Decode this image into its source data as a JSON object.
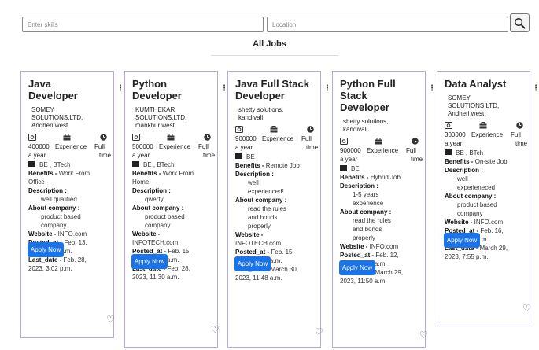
{
  "search": {
    "skills_placeholder": "Enter skills",
    "location_placeholder": "Location"
  },
  "page": {
    "title": "All Jobs"
  },
  "labels": {
    "benefits": "Benefits -",
    "description": "Description :",
    "about": "About company :",
    "website": "Website -",
    "posted": "Posted_at -",
    "last": "Last_date -",
    "apply": "Apply Now",
    "experience": "Experience",
    "full": "Full",
    "time": "time",
    "a_year": "a year"
  },
  "icons": {
    "salary": "money-icon",
    "experience": "briefcase-icon",
    "type": "clock-icon",
    "education": "graduation-cap-icon",
    "favorite": "heart-icon",
    "more": "kebab-menu-icon",
    "search": "magnifier-icon"
  },
  "colors": {
    "card_border": "#b9a8e3",
    "apply_button": "#1a73e8"
  },
  "jobs": [
    {
      "title_lines": [
        "Java",
        "Developer"
      ],
      "company_lines": [
        "SOMEY",
        "SOLUTIONS.LTD,",
        "Andheri west."
      ],
      "salary": "400000",
      "education": "BE , BTech",
      "benefits_lines": [
        "Work From",
        "Office"
      ],
      "description_lines": [
        "well qualified"
      ],
      "about_lines": [
        "product based",
        "company"
      ],
      "website": "INFO.com",
      "posted_lines": [
        "Feb. 13,",
        "2023, 3:02 p.m."
      ],
      "last_lines": [
        "Feb. 28,",
        "2023, 3:02 p.m."
      ]
    },
    {
      "title_lines": [
        "Python",
        "Developer"
      ],
      "company_lines": [
        "KUMTHEKAR",
        "SOLUTIONS.LTD,",
        "mankhur west."
      ],
      "salary": "500000",
      "education": "BE , BTech",
      "benefits_lines": [
        "Work From",
        "Home"
      ],
      "description_lines": [
        "qwerty"
      ],
      "about_lines": [
        "product based",
        "company"
      ],
      "website": "INFOTECH.com",
      "website_split": true,
      "posted_lines": [
        "Feb. 15,",
        "2023, 11:32 a.m."
      ],
      "last_lines": [
        "Feb. 28,",
        "2023, 11:30 a.m."
      ]
    },
    {
      "title_lines": [
        "Java Full Stack",
        "Developer"
      ],
      "company_lines": [
        "shetty solutions,",
        "kandivali."
      ],
      "salary": "900000",
      "education": "BE",
      "benefits_lines": [
        "Remote Job"
      ],
      "description_lines": [
        "well",
        "experienced!"
      ],
      "about_lines": [
        "read the rules",
        "and bonds",
        "properly"
      ],
      "website": "INFOTECH.com",
      "website_split": true,
      "posted_lines": [
        "Feb. 15,",
        "2023, 11:48 a.m."
      ],
      "last_lines": [
        "March 30,",
        "2023, 11:48 a.m."
      ]
    },
    {
      "title_lines": [
        "Python Full",
        "Stack",
        "Developer"
      ],
      "company_lines": [
        "shetty solutions,",
        "kandivali."
      ],
      "salary": "900000",
      "education": "BE",
      "benefits_lines": [
        "Hybrid Job"
      ],
      "description_lines": [
        "1-5 years",
        "experience"
      ],
      "about_lines": [
        "read the rules",
        "and bonds",
        "properly"
      ],
      "website": "INFO.com",
      "posted_lines": [
        "Feb. 12,",
        "2023, 11:50 a.m."
      ],
      "last_lines": [
        "March 29,",
        "2023, 11:50 a.m."
      ]
    },
    {
      "title_lines": [
        "Data Analyst"
      ],
      "company_lines": [
        "SOMEY",
        "SOLUTIONS.LTD,",
        "Andheri west."
      ],
      "salary": "300000",
      "education": "BE , BTch",
      "benefits_lines": [
        "On-site Job"
      ],
      "description_lines": [
        "well",
        "experieneced"
      ],
      "about_lines": [
        "product based",
        "company"
      ],
      "website": "INFO.com",
      "posted_lines": [
        "Feb. 16,",
        "2023, 7:55 p.m."
      ],
      "last_lines": [
        "March 29,",
        "2023, 7:55 p.m."
      ]
    }
  ]
}
